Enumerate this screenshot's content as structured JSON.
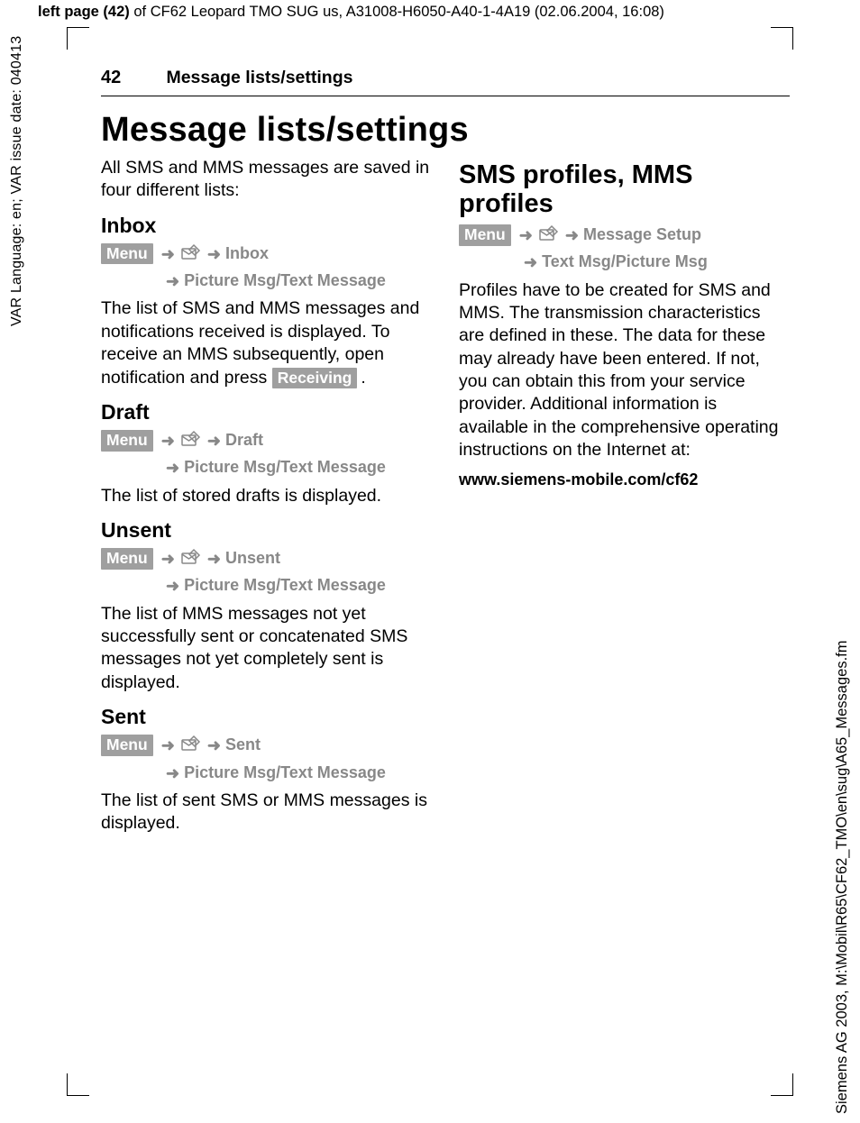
{
  "meta": {
    "top_bold": "left page (42)",
    "top_rest": " of CF62 Leopard TMO SUG us, A31008-H6050-A40-1-4A19 (02.06.2004, 16:08)",
    "left_vert": "VAR Language: en; VAR issue date: 040413",
    "right_vert": "Siemens AG 2003, M:\\Mobil\\R65\\CF62_TMO\\en\\sug\\A65_Messages.fm"
  },
  "runhead": {
    "page_no": "42",
    "title": "Message lists/settings"
  },
  "h1": "Message lists/settings",
  "intro": "All SMS and MMS messages are saved in four different lists:",
  "badges": {
    "menu": "Menu",
    "receiving": "Receiving"
  },
  "arrows": {
    "right": "➜"
  },
  "left": {
    "inbox": {
      "head": "Inbox",
      "nav1": "Inbox",
      "nav2": "Picture Msg/Text Message",
      "text_a": "The list of SMS and MMS messages and notifications received is displayed. To receive an MMS subsequently, open notification and press ",
      "text_b": "."
    },
    "draft": {
      "head": "Draft",
      "nav1": "Draft",
      "nav2": "Picture Msg/Text Message",
      "text": "The list of stored drafts is displayed."
    },
    "unsent": {
      "head": "Unsent",
      "nav1": "Unsent",
      "nav2": "Picture Msg/Text Message",
      "text": "The list of MMS messages not yet successfully sent or concatenated SMS messages not yet completely sent is displayed."
    },
    "sent": {
      "head": "Sent",
      "nav1": "Sent",
      "nav2": "Picture Msg/Text Message",
      "text": "The list of sent SMS or MMS messages is displayed."
    }
  },
  "right": {
    "head": "SMS profiles, MMS profiles",
    "nav1": "Message Setup",
    "nav2": "Text Msg/Picture Msg",
    "text": "Profiles have to be created for SMS and MMS. The transmission characteristics are defined in these. The data for these may already have been entered. If not, you can obtain this from your service provider. Additional information is available in the comprehensive operating instructions on the Internet at:",
    "url": "www.siemens-mobile.com/cf62"
  }
}
